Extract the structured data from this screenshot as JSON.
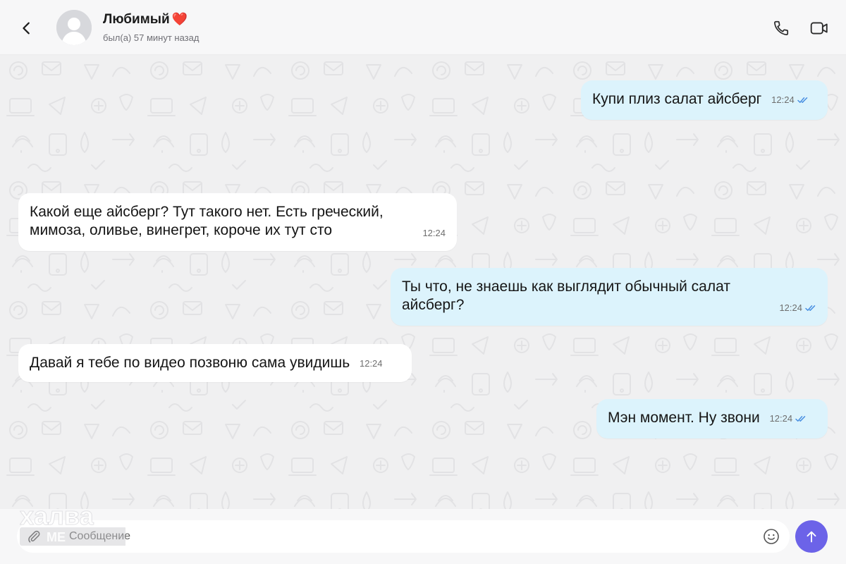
{
  "header": {
    "contact_name": "Любимый",
    "heart": "❤️",
    "status": "был(а) 57 минут назад"
  },
  "messages": [
    {
      "direction": "out",
      "text": "Купи плиз салат айсберг",
      "time": "12:24",
      "read": true
    },
    {
      "direction": "in",
      "text": "Какой еще айсберг? Тут такого нет. Есть греческий, мимоза, оливье, винегрет, короче их тут сто",
      "time": "12:24"
    },
    {
      "direction": "out",
      "text": "Ты что, не знаешь как выглядит обычный салат айсберг?",
      "time": "12:24",
      "read": true
    },
    {
      "direction": "in",
      "text": "Давай я тебе по видео позвоню сама увидишь",
      "time": "12:24"
    },
    {
      "direction": "out",
      "text": "Мэн момент. Ну звони",
      "time": "12:24",
      "read": true
    }
  ],
  "composer": {
    "placeholder": "Сообщение",
    "value": ""
  },
  "watermark": {
    "line1": "халва",
    "line2": "МЕДИА"
  },
  "colors": {
    "outgoing_bubble": "#dcf3fc",
    "incoming_bubble": "#ffffff",
    "send_button": "#6c63e8",
    "read_check": "#4a90e2"
  },
  "icons": {
    "back": "chevron-left-icon",
    "call": "phone-icon",
    "video": "video-camera-icon",
    "attach": "paperclip-icon",
    "emoji": "smiley-icon",
    "send": "arrow-up-icon",
    "read": "double-check-icon"
  }
}
